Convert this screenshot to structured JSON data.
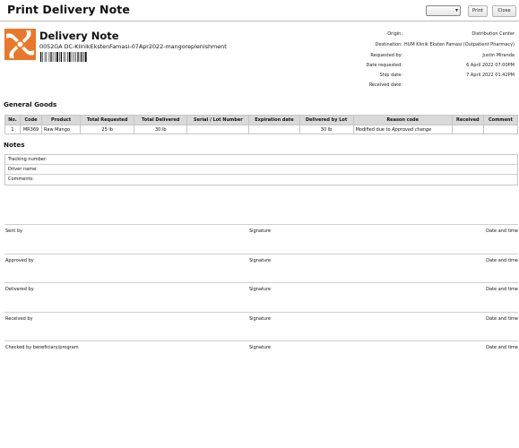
{
  "header": {
    "title": "Print Delivery Note",
    "language_value": "",
    "print_label": "Print",
    "close_label": "Close"
  },
  "document": {
    "title": "Delivery Note",
    "number": "0052GA DC-KlinikEkstenFamasi-07Apr2022-mangoreplenishment"
  },
  "meta": [
    {
      "label": "Origin:",
      "value": "Distribution Center"
    },
    {
      "label": "Destination:",
      "value": "HUM Klinik Eksten Famasi (Outpatient Pharmacy)"
    },
    {
      "label": "Requested by:",
      "value": "Justin Miranda"
    },
    {
      "label": "Date requested:",
      "value": "6 April 2022 07:00PM"
    },
    {
      "label": "Ship date:",
      "value": "7 April 2022 01:42PM"
    },
    {
      "label": "Received date:",
      "value": ""
    }
  ],
  "goods": {
    "section_title": "General Goods",
    "columns": [
      "No.",
      "Code",
      "Product",
      "Total Requested",
      "Total Delivered",
      "Serial / Lot Number",
      "Expiration date",
      "Delivered by Lot",
      "Reason code",
      "Received",
      "Comment"
    ],
    "rows": [
      {
        "no": "1",
        "code": "MR369",
        "product": "Raw Mango",
        "total_requested": "25 lb",
        "total_delivered": "30 lb",
        "serial_lot": "",
        "expiration": "",
        "delivered_by_lot": "30 lb",
        "reason_prefix": "Modified due to",
        "reason_emphasis": "Approved change",
        "received": "",
        "comment": ""
      }
    ]
  },
  "notes": {
    "section_title": "Notes",
    "fields": [
      "Tracking number:",
      "Driver name:",
      "Comments:"
    ]
  },
  "signatures": {
    "signature_label": "Signature",
    "date_label": "Date and time",
    "rows": [
      "Sent by",
      "Approved by",
      "Delivered by",
      "Received by",
      "Checked by beneficiary/program"
    ]
  },
  "icons": {
    "logo": "hands-circle-logo-icon",
    "logo_color": "#E8782A",
    "dropdown": "chevron-down-icon"
  }
}
